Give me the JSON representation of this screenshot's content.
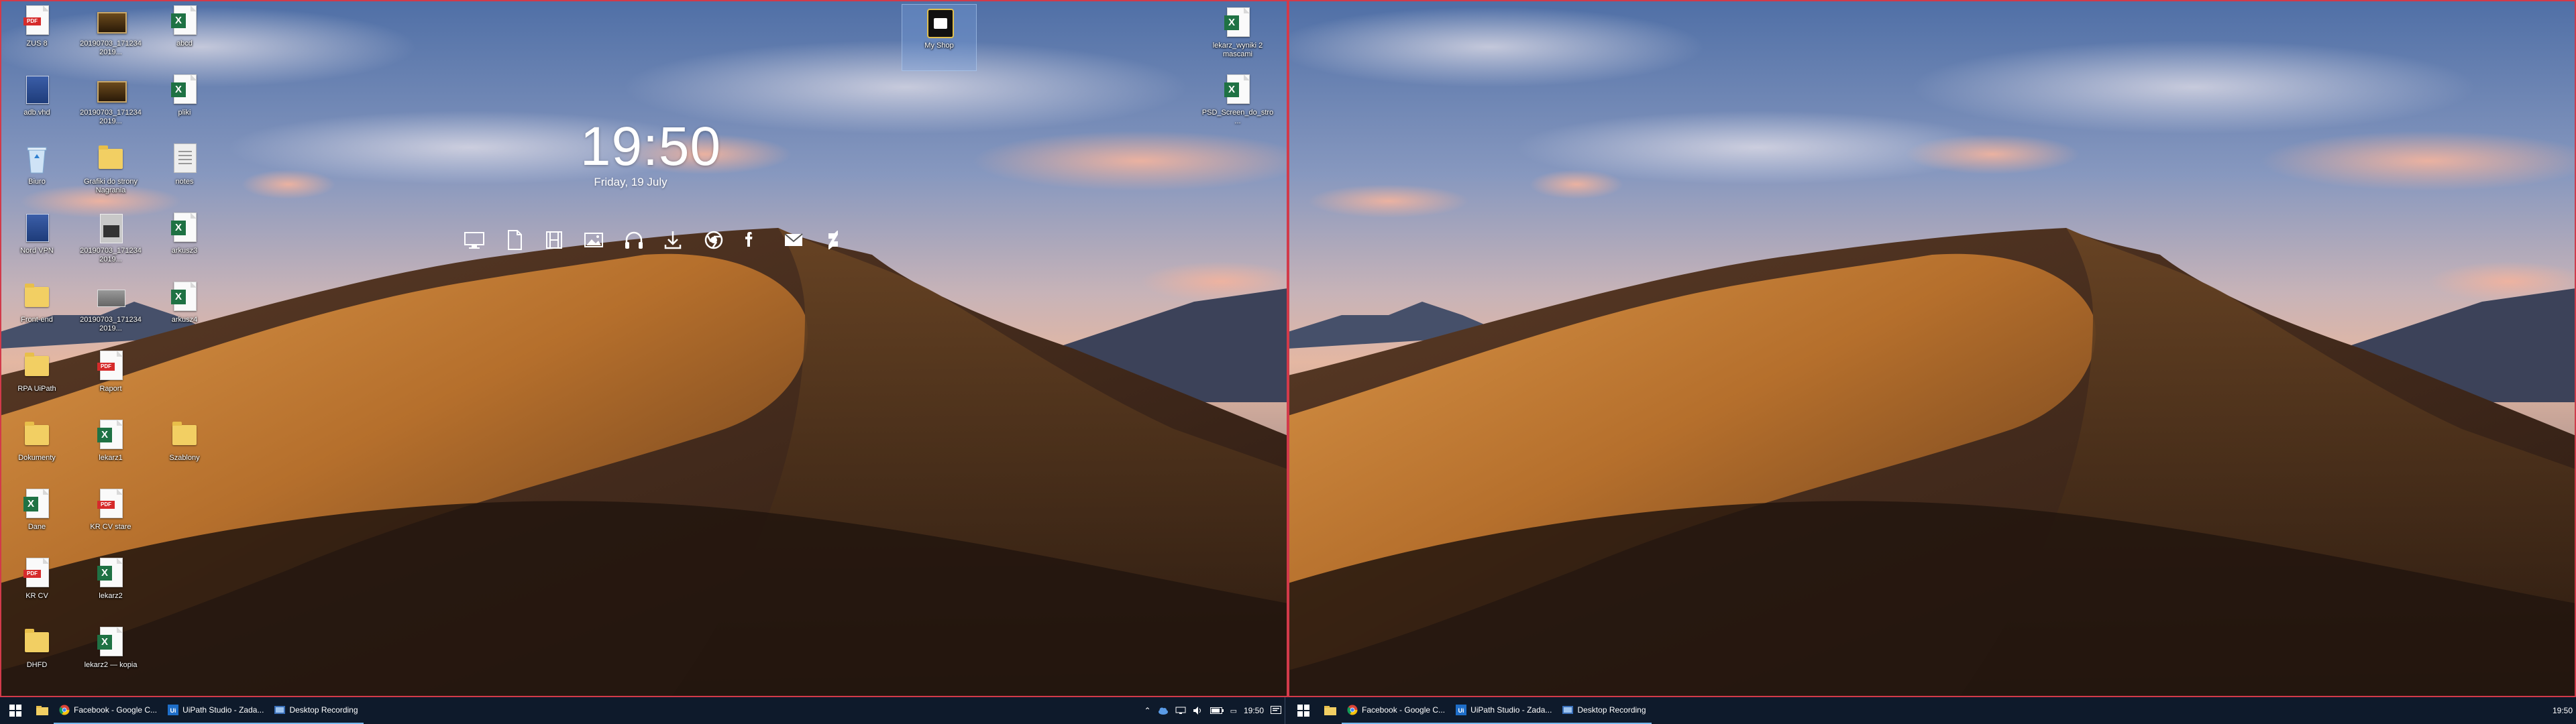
{
  "clock": {
    "time": "19:50",
    "date": "Friday, 19 July"
  },
  "desktop_icons": [
    {
      "label": "ZUS 8",
      "type": "pdf"
    },
    {
      "label": "20190703_171234 2019...",
      "type": "photo"
    },
    {
      "label": "abcd",
      "type": "excel"
    },
    {
      "label": "adb.vhd",
      "type": "generic"
    },
    {
      "label": "20190703_171234 2019...",
      "type": "photo"
    },
    {
      "label": "pliki",
      "type": "excel"
    },
    {
      "label": "Biuro",
      "type": "recycle"
    },
    {
      "label": "Grafiki do strony Nagrania",
      "type": "folder"
    },
    {
      "label": "notes",
      "type": "paper"
    },
    {
      "label": "Nord VPN",
      "type": "generic"
    },
    {
      "label": "20190703_171234 2019...",
      "type": "mm"
    },
    {
      "label": "arkusz3",
      "type": "excel"
    },
    {
      "label": "Front-end",
      "type": "folder"
    },
    {
      "label": "20190703_171234 2019...",
      "type": "gray"
    },
    {
      "label": "arkusz4",
      "type": "excel"
    },
    {
      "label": "RPA UiPath",
      "type": "folder"
    },
    {
      "label": "Raport",
      "type": "pdf"
    },
    {
      "label": "Szablony",
      "type": "folder"
    },
    {
      "label": "lekarz1",
      "type": "excel"
    },
    {
      "label": "Dokumenty",
      "type": "folder"
    },
    {
      "label": "Dane",
      "type": "excel"
    },
    {
      "label": "KR CV stare",
      "type": "pdf"
    },
    {
      "label": "KR CV",
      "type": "pdf"
    },
    {
      "label": "lekarz2",
      "type": "excel"
    },
    {
      "label": "DHFD",
      "type": "folder"
    },
    {
      "label": "lekarz2 — kopia",
      "type": "excel"
    },
    {
      "label": "My Shop",
      "type": "recorder"
    },
    {
      "label": "lekarz_wyniki 2 mascami",
      "type": "excel"
    },
    {
      "label": "PSD_Screen_do_stro...",
      "type": "excel"
    }
  ],
  "launcher_icons": [
    "monitor-icon",
    "document-icon",
    "film-icon",
    "image-icon",
    "headphones-icon",
    "download-icon",
    "chrome-icon",
    "facebook-icon",
    "mail-icon",
    "deviantart-icon"
  ],
  "taskbar": {
    "items": [
      {
        "label": "Facebook - Google C...",
        "icon": "chrome-icon"
      },
      {
        "label": "UiPath Studio - Zada...",
        "icon": "uipath-icon"
      },
      {
        "label": "Desktop Recording",
        "icon": "recording-icon"
      }
    ],
    "tray_time": "19:50"
  },
  "colors": {
    "taskbar": "#0e1a2b",
    "frame": "#d23a4a",
    "accent": "#76b9ed"
  }
}
